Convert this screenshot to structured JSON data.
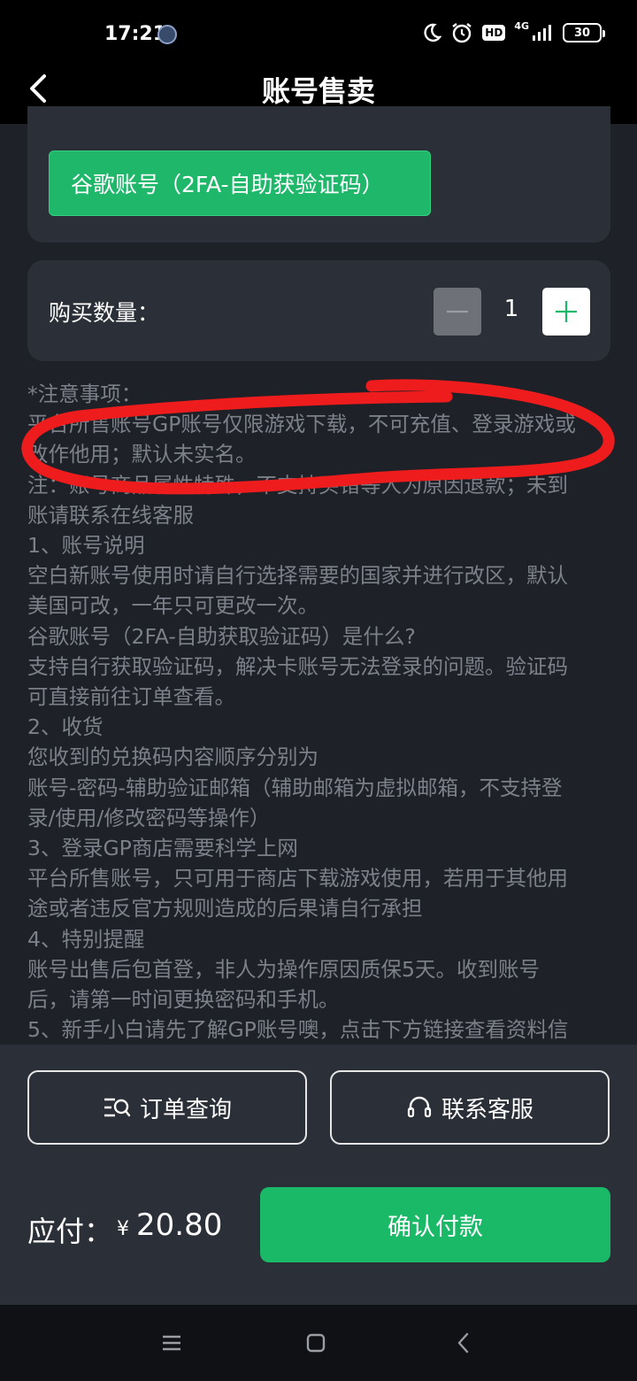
{
  "status_bar": {
    "time": "17:21",
    "network": "4G",
    "hd": "HD",
    "battery": "30"
  },
  "header": {
    "title": "账号售卖"
  },
  "product": {
    "selected": "谷歌账号（2FA-自助获验证码）"
  },
  "quantity": {
    "label": "购买数量：",
    "value": "1"
  },
  "notes": {
    "lines": [
      "*注意事项：",
      "平台所售账号GP账号仅限游戏下载，不可充值、登录游戏或",
      "改作他用；默认未实名。",
      "注：账号商品属性特殊，不支持买错等人为原因退款；未到",
      "账请联系在线客服",
      "1、账号说明",
      "空白新账号使用时请自行选择需要的国家并进行改区，默认",
      "美国可改，一年只可更改一次。",
      "谷歌账号（2FA-自助获取验证码）是什么?",
      "支持自行获取验证码，解决卡账号无法登录的问题。验证码",
      "可直接前往订单查看。",
      "2、收货",
      "您收到的兑换码内容顺序分别为",
      "账号-密码-辅助验证邮箱（辅助邮箱为虚拟邮箱，不支持登",
      "录/使用/修改密码等操作）",
      "3、登录GP商店需要科学上网",
      "平台所售账号，只可用于商店下载游戏使用，若用于其他用",
      "途或者违反官方规则造成的后果请自行承担",
      "4、特别提醒",
      "账号出售后包首登，非人为操作原因质保5天。收到账号",
      "后，请第一时间更换密码和手机。",
      "5、新手小白请先了解GP账号噢，点击下方链接查看资料信"
    ]
  },
  "actions": {
    "order_query": "订单查询",
    "contact_service": "联系客服"
  },
  "payment": {
    "label": "应付：",
    "currency": "¥",
    "amount": "20.80",
    "confirm": "确认付款"
  },
  "colors": {
    "accent": "#1ab967",
    "background": "#1e2127",
    "card": "#2b2f37",
    "annotation": "#ee1c1c"
  }
}
